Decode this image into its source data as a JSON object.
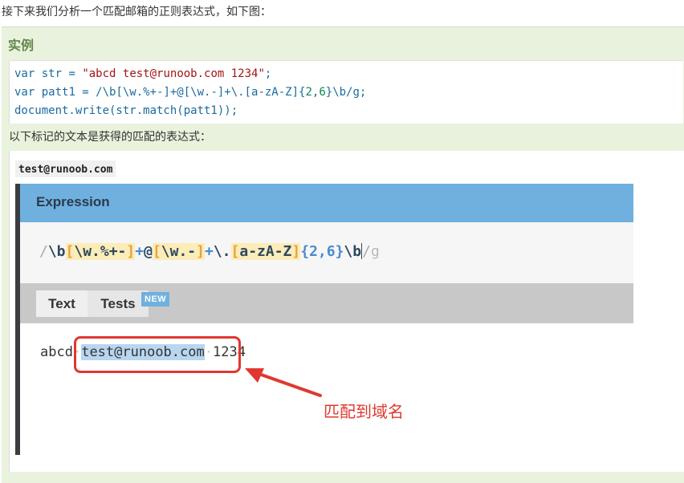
{
  "intro_text": "接下来我们分析一个匹配邮箱的正则表达式，如下图：",
  "example": {
    "title": "实例",
    "code": {
      "line1": {
        "kw": "var",
        "rest": " str = ",
        "str": "\"abcd test@runoob.com 1234\"",
        "end": ";"
      },
      "line2": {
        "kw": "var",
        "rest": " patt1 = /\\b[\\w.%+-]+@[\\w.-]+\\.[a-zA-Z]{",
        "n1": "2",
        "comma": ",",
        "n2": "6",
        "end": "}\\b/g;"
      },
      "line3": "document.write(str.match(patt1));"
    },
    "note": "以下标记的文本是获得的匹配的表达式：",
    "inline_code": "test@runoob.com"
  },
  "screenshot": {
    "header_title": "Expression",
    "expression": {
      "open": "/",
      "p1": "\\b",
      "p2_open": "[",
      "p2_body": "\\w.%+-",
      "p2_close": "]",
      "p3": "+",
      "p4": "@",
      "p5_open": "[",
      "p5_body": "\\w.-",
      "p5_close": "]",
      "p6": "+",
      "p7": "\\.",
      "p8_open": "[",
      "p8_body": "a-zA-Z",
      "p8_close": "]",
      "p9": "{2,6}",
      "p10": "\\b",
      "close": "/",
      "flag": "g"
    },
    "tabs": {
      "text": "Text",
      "tests": "Tests",
      "badge": "NEW"
    },
    "test_text": {
      "before": "abcd",
      "match": "test@runoob.com",
      "after": "1234",
      "space": "·"
    },
    "callout": "匹配到域名"
  },
  "colors": {
    "accent": "#6fb0df",
    "highlight": "#e0382f",
    "example_bg": "#e9f2dc"
  }
}
